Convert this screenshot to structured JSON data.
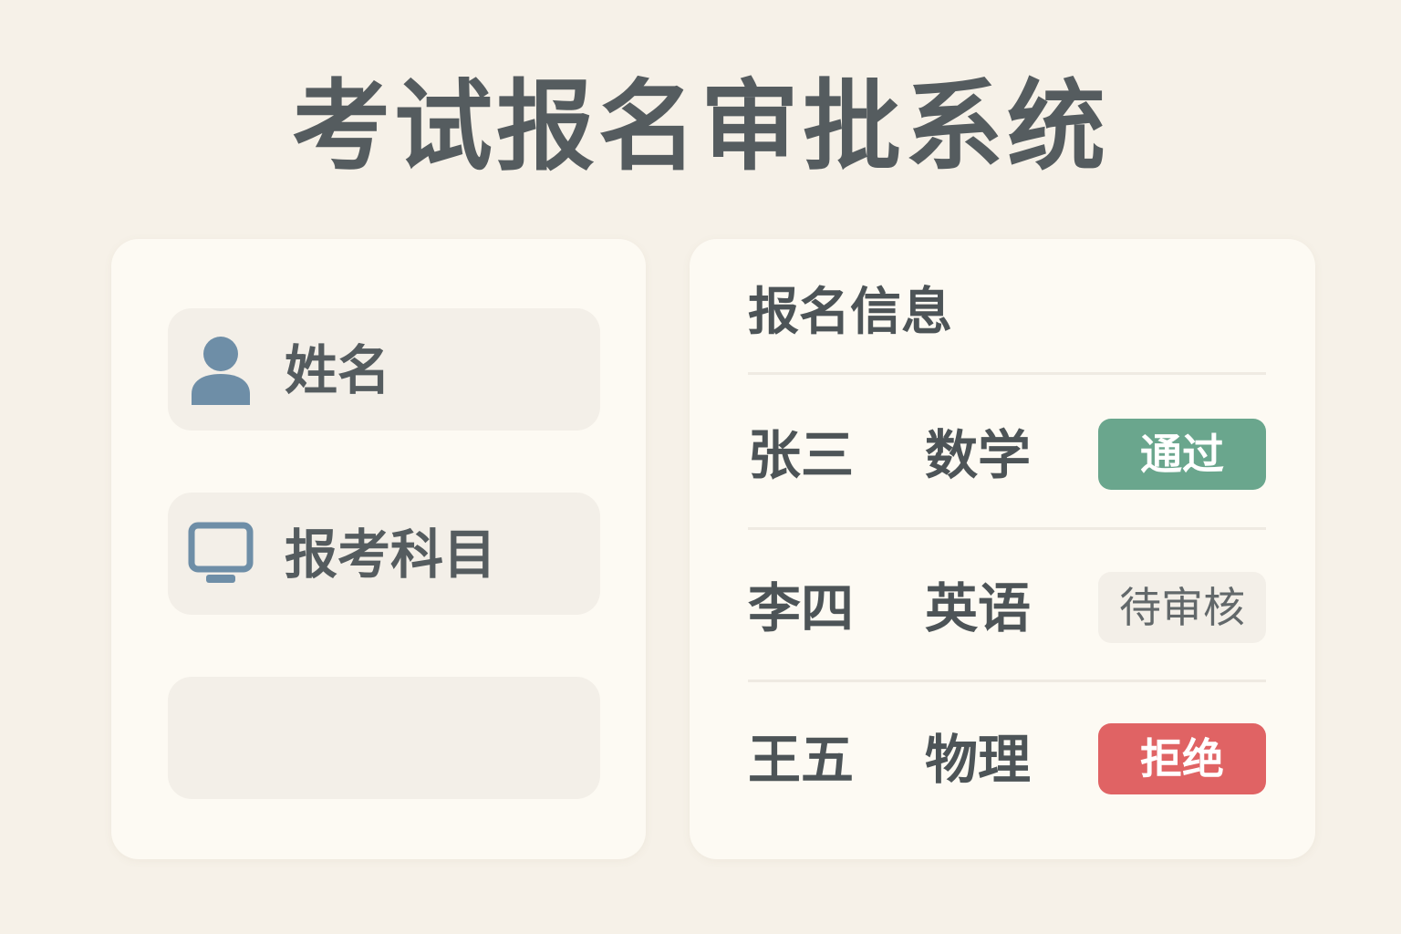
{
  "app": {
    "title": "考试报名审批系统"
  },
  "form_panel": {
    "fields": [
      {
        "label": "姓名",
        "icon": "user-icon",
        "value": ""
      },
      {
        "label": "报考科目",
        "icon": "monitor-icon",
        "value": ""
      },
      {
        "label": "",
        "icon": "",
        "value": ""
      }
    ]
  },
  "info_panel": {
    "title": "报名信息",
    "rows": [
      {
        "name": "张三",
        "subject": "数学",
        "status": "通过",
        "status_type": "approved"
      },
      {
        "name": "李四",
        "subject": "英语",
        "status": "待审核",
        "status_type": "pending"
      },
      {
        "name": "王五",
        "subject": "物理",
        "status": "拒绝",
        "status_type": "rejected"
      }
    ]
  },
  "colors": {
    "background": "#f6f1e8",
    "panel": "#fdfaf3",
    "field": "#f3efe8",
    "text": "#555c5f",
    "icon": "#6e8ea7",
    "approved": "#6aa68d",
    "pending": "#f3efe8",
    "rejected": "#e06364"
  }
}
